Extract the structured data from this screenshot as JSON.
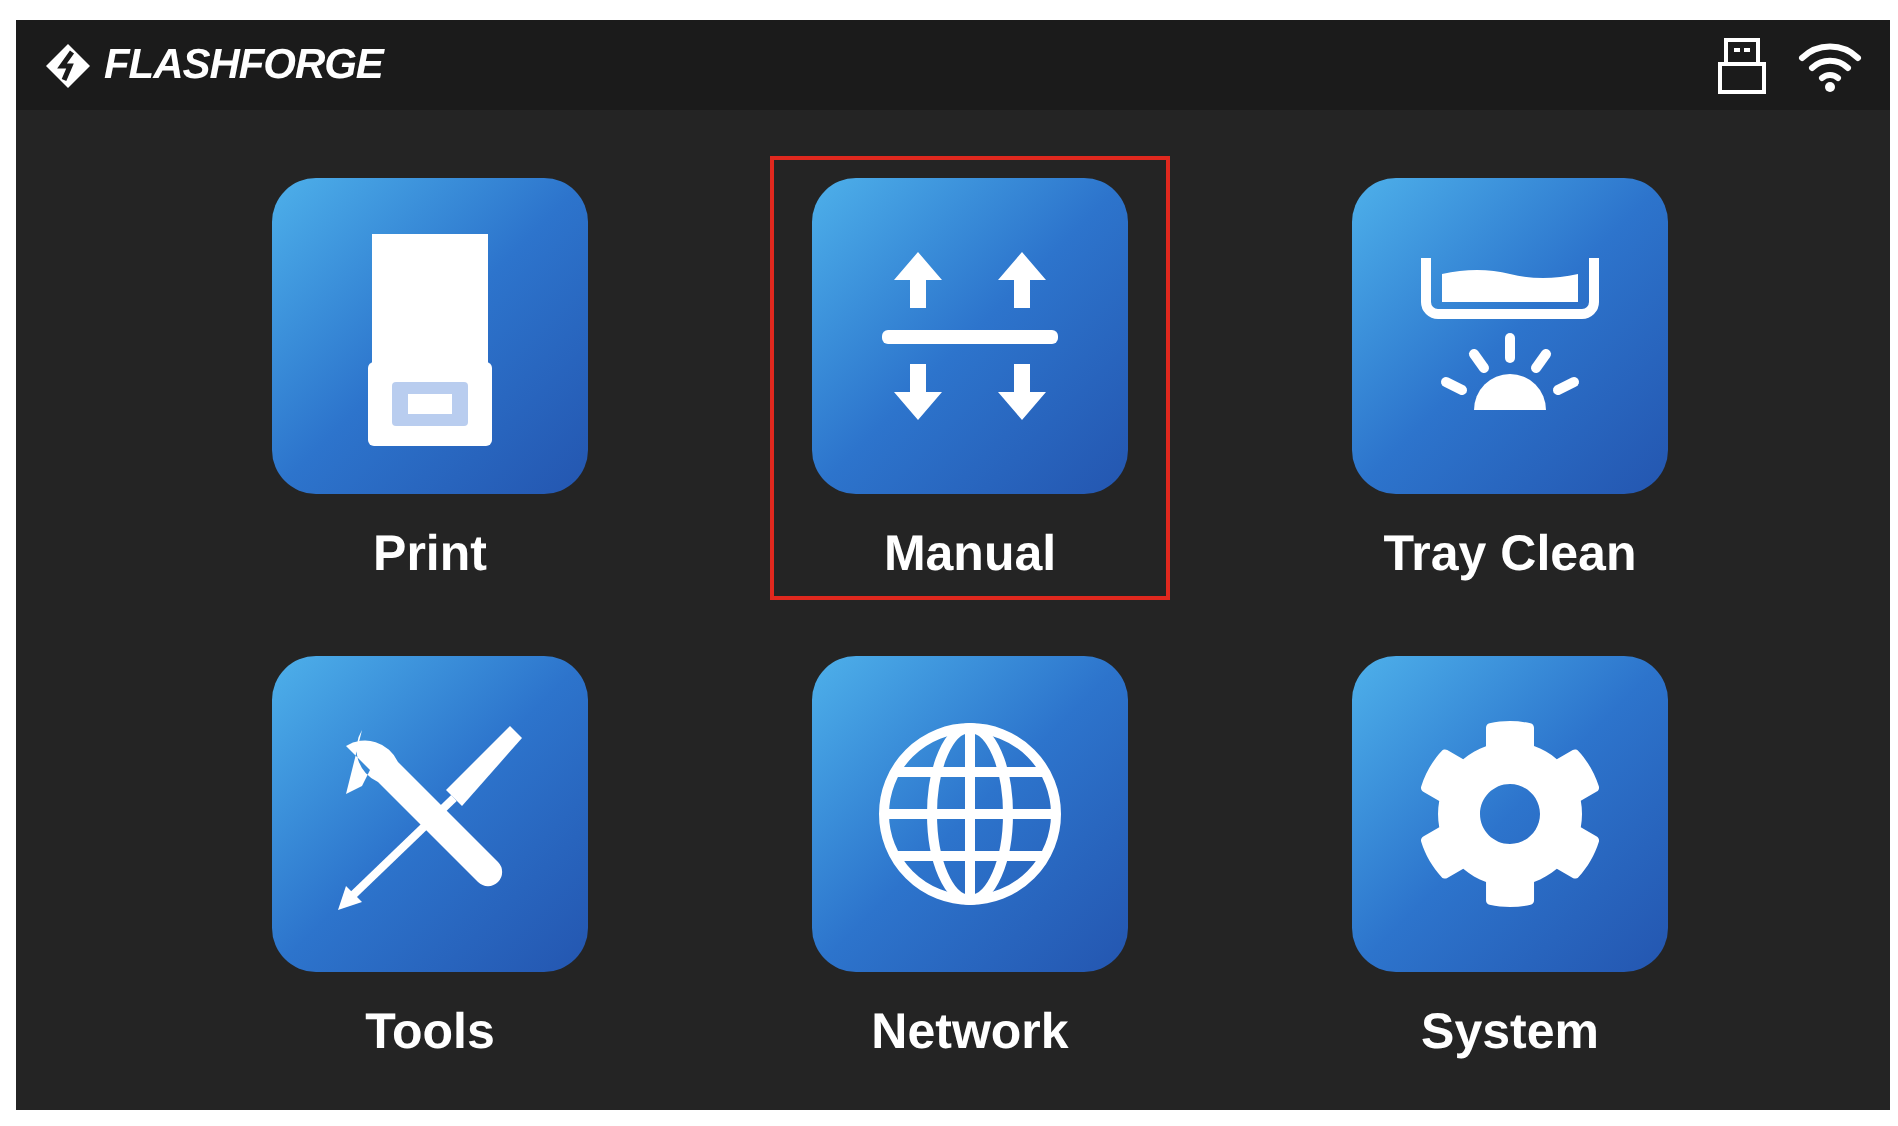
{
  "header": {
    "brand": "FLASHFORGE"
  },
  "tiles": [
    {
      "kind": "print",
      "label": "Print",
      "selected": false
    },
    {
      "kind": "manual",
      "label": "Manual",
      "selected": true
    },
    {
      "kind": "tray_clean",
      "label": "Tray Clean",
      "selected": false
    },
    {
      "kind": "tools",
      "label": "Tools",
      "selected": false
    },
    {
      "kind": "network",
      "label": "Network",
      "selected": false
    },
    {
      "kind": "system",
      "label": "System",
      "selected": false
    }
  ]
}
